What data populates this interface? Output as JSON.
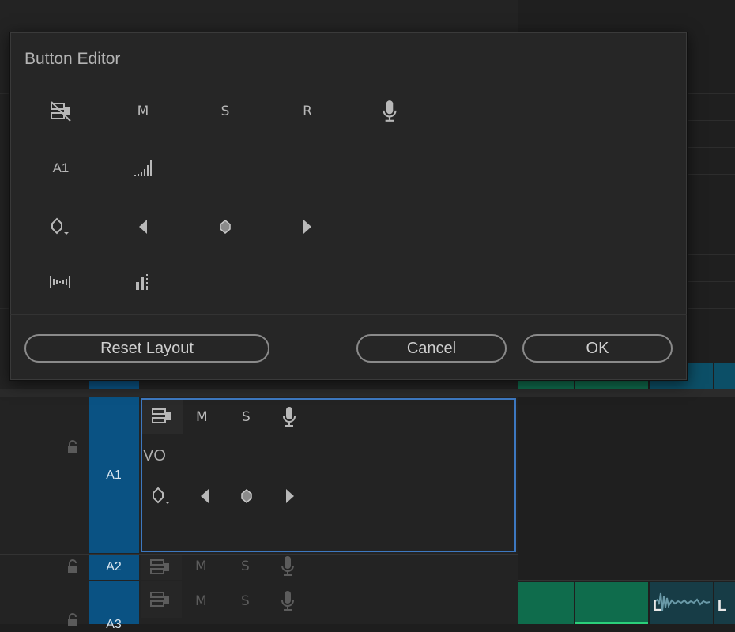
{
  "dialog": {
    "title": "Button Editor",
    "rows": [
      [
        {
          "icon": "toggle-sync-lock-icon",
          "text": ""
        },
        {
          "icon": "mute-track-icon",
          "text": "M"
        },
        {
          "icon": "solo-track-icon",
          "text": "S"
        },
        {
          "icon": "read-automation-icon",
          "text": "R"
        },
        {
          "icon": "voice-over-record-icon",
          "text": ""
        }
      ],
      [
        {
          "icon": "track-name-icon",
          "text": "A1"
        },
        {
          "icon": "track-meter-icon",
          "text": ""
        }
      ],
      [
        {
          "icon": "show-keyframes-icon",
          "text": ""
        },
        {
          "icon": "previous-keyframe-icon",
          "text": ""
        },
        {
          "icon": "add-keyframe-icon",
          "text": ""
        },
        {
          "icon": "next-keyframe-icon",
          "text": ""
        }
      ],
      [
        {
          "icon": "audio-waveform-icon",
          "text": ""
        },
        {
          "icon": "track-volume-meter-icon",
          "text": ""
        }
      ]
    ],
    "buttons": {
      "reset": "Reset Layout",
      "cancel": "Cancel",
      "ok": "OK"
    }
  },
  "timeline": {
    "tracks": [
      {
        "label": "A1",
        "name": "VO",
        "buttons": {
          "mute": "M",
          "solo": "S"
        }
      },
      {
        "label": "A2",
        "buttons": {
          "mute": "M",
          "solo": "S"
        }
      },
      {
        "label": "A3",
        "buttons": {
          "mute": "M",
          "solo": "S"
        }
      }
    ],
    "clip_labels": [
      "L",
      "L"
    ]
  },
  "colors": {
    "track_label_bg": "#0a5283",
    "selection_border": "#3d78c0",
    "clip_green": "#0f6c4c",
    "clip_teal": "#0c4f67",
    "modal_bg": "#262626"
  }
}
